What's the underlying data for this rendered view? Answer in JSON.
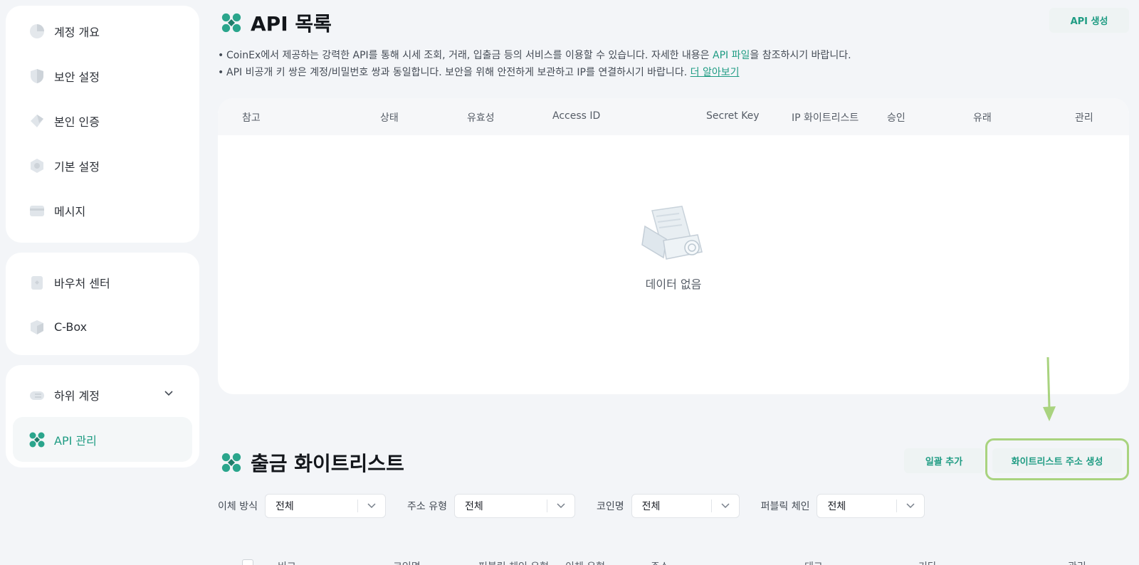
{
  "sidebar": {
    "group1": [
      {
        "label": "계정 개요",
        "icon": "pie-chart-icon"
      },
      {
        "label": "보안 설정",
        "icon": "shield-icon"
      },
      {
        "label": "본인 인증",
        "icon": "id-tag-icon"
      },
      {
        "label": "기본 설정",
        "icon": "settings-hex-icon"
      },
      {
        "label": "메시지",
        "icon": "message-card-icon"
      }
    ],
    "group2": [
      {
        "label": "바우처 센터",
        "icon": "voucher-icon"
      },
      {
        "label": "C-Box",
        "icon": "gift-box-icon"
      }
    ],
    "group3": [
      {
        "label": "하위 계정",
        "icon": "sub-account-icon"
      },
      {
        "label": "API 관리",
        "icon": "api-logo-icon"
      }
    ]
  },
  "api_section": {
    "title": "API 목록",
    "create_button": "API 생성",
    "note1_a": "CoinEx에서 제공하는 강력한 API를 통해 시세 조회, 거래, 입출금 등의 서비스를 이용할 수 있습니다. 자세한 내용은 ",
    "note1_link": "API 파일",
    "note1_b": "을 참조하시기 바랍니다.",
    "note2_a": "API 비공개 키 쌍은 계정/비밀번호 쌍과 동일합니다. 보안을 위해 안전하게 보관하고 IP를 연결하시기 바랍니다. ",
    "note2_link": "더 알아보기",
    "columns": [
      "참고",
      "상태",
      "유효성",
      "Access ID",
      "Secret Key",
      "IP 화이트리스트",
      "승인",
      "유래",
      "관리"
    ],
    "empty_text": "데이터 없음"
  },
  "whitelist_section": {
    "title": "출금 화이트리스트",
    "bulk_add_button": "일괄 추가",
    "create_button": "화이트리스트 주소 생성",
    "filters": [
      {
        "label": "이체 방식",
        "value": "전체"
      },
      {
        "label": "주소 유형",
        "value": "전체"
      },
      {
        "label": "코인명",
        "value": "전체"
      },
      {
        "label": "퍼블릭 체인",
        "value": "전체"
      }
    ],
    "columns": [
      "비고",
      "코인명",
      "퍼블릭 체인 유형",
      "이체 유형",
      "주소",
      "태그",
      "기타",
      "관리"
    ]
  },
  "colors": {
    "accent": "#1f9c83",
    "highlight": "#a9d37f"
  }
}
